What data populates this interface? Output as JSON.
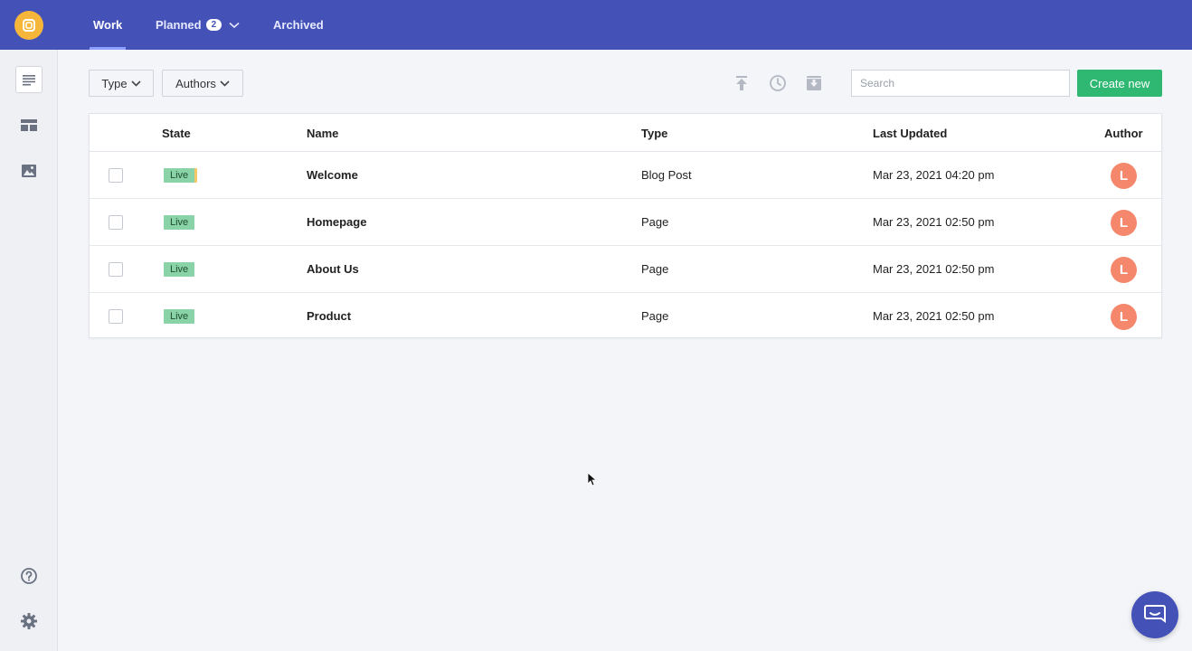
{
  "colors": {
    "header_bg": "#4452b8",
    "accent_green": "#2eb872",
    "status_live": "#8ad3a8",
    "avatar": "#f4876c",
    "logo": "#f5b63a"
  },
  "sidebar": {
    "items": [
      {
        "icon": "document-list-icon"
      },
      {
        "icon": "layout-icon"
      },
      {
        "icon": "image-icon"
      }
    ],
    "bottom": [
      {
        "icon": "help-icon"
      },
      {
        "icon": "gear-icon"
      }
    ]
  },
  "nav": {
    "tabs": [
      {
        "label": "Work",
        "active": true
      },
      {
        "label": "Planned",
        "badge": "2"
      },
      {
        "label": "Archived"
      }
    ]
  },
  "toolbar": {
    "type_filter": "Type",
    "authors_filter": "Authors",
    "icons": [
      "publish-icon",
      "schedule-icon",
      "archive-icon"
    ],
    "search_placeholder": "Search",
    "create_label": "Create new"
  },
  "table": {
    "headers": {
      "state": "State",
      "name": "Name",
      "type": "Type",
      "last_updated": "Last Updated",
      "author": "Author"
    },
    "rows": [
      {
        "state": "Live",
        "name": "Welcome",
        "type": "Blog Post",
        "updated": "Mar 23, 2021 04:20 pm",
        "author_initial": "L"
      },
      {
        "state": "Live",
        "name": "Homepage",
        "type": "Page",
        "updated": "Mar 23, 2021 02:50 pm",
        "author_initial": "L"
      },
      {
        "state": "Live",
        "name": "About Us",
        "type": "Page",
        "updated": "Mar 23, 2021 02:50 pm",
        "author_initial": "L"
      },
      {
        "state": "Live",
        "name": "Product",
        "type": "Page",
        "updated": "Mar 23, 2021 02:50 pm",
        "author_initial": "L"
      }
    ]
  }
}
